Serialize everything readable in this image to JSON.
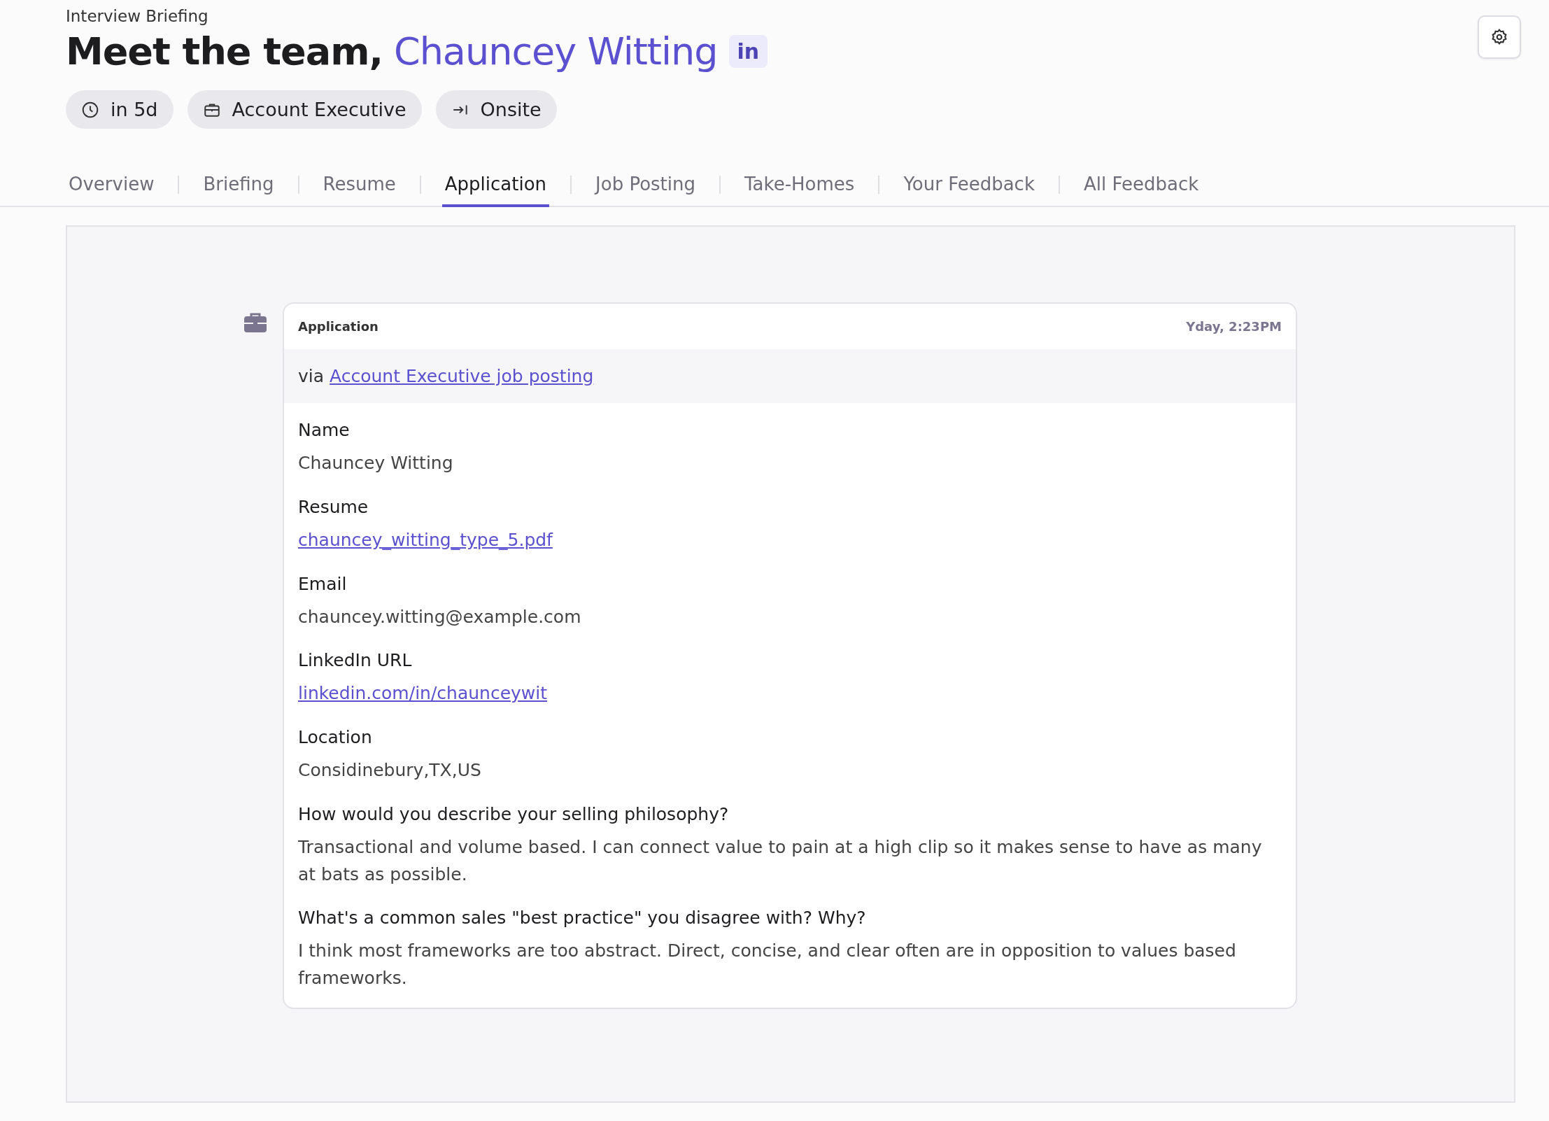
{
  "header": {
    "eyebrow": "Interview Briefing",
    "title_prefix": "Meet the team,",
    "candidate_name": "Chauncey Witting",
    "profile_badge": "in"
  },
  "chips": [
    {
      "kind": "time",
      "label": "in 5d"
    },
    {
      "kind": "role",
      "label": "Account Executive"
    },
    {
      "kind": "stage",
      "label": "Onsite"
    }
  ],
  "tabs": [
    {
      "label": "Overview",
      "selected": false
    },
    {
      "label": "Briefing",
      "selected": false
    },
    {
      "label": "Resume",
      "selected": false
    },
    {
      "label": "Application",
      "selected": true
    },
    {
      "label": "Job Posting",
      "selected": false
    },
    {
      "label": "Take-Homes",
      "selected": false
    },
    {
      "label": "Your Feedback",
      "selected": false
    },
    {
      "label": "All Feedback",
      "selected": false
    }
  ],
  "application": {
    "title": "Application",
    "time": "Yday, 2:23PM",
    "source_prefix": "via",
    "source_link": "Account Executive job posting",
    "fields": [
      {
        "label": "Name",
        "value": "Chauncey Witting",
        "kind": "text"
      },
      {
        "label": "Resume",
        "value": "chauncey_witting_type_5.pdf",
        "kind": "link"
      },
      {
        "label": "Email",
        "value": "chauncey.witting@example.com",
        "kind": "text"
      },
      {
        "label": "LinkedIn URL",
        "value": "linkedin.com/in/chaunceywit",
        "kind": "link"
      },
      {
        "label": "Location",
        "value": "Considinebury,TX,US",
        "kind": "text"
      },
      {
        "label": "How would you describe your selling philosophy?",
        "value": "Transactional and volume based. I can connect value to pain at a high clip so it makes sense to have as many at bats as possible.",
        "kind": "text"
      },
      {
        "label": "What's a common sales \"best practice\" you disagree with? Why?",
        "value": "I think most frameworks are too abstract. Direct, concise, and clear often are in opposition to values based frameworks.",
        "kind": "text"
      }
    ]
  }
}
